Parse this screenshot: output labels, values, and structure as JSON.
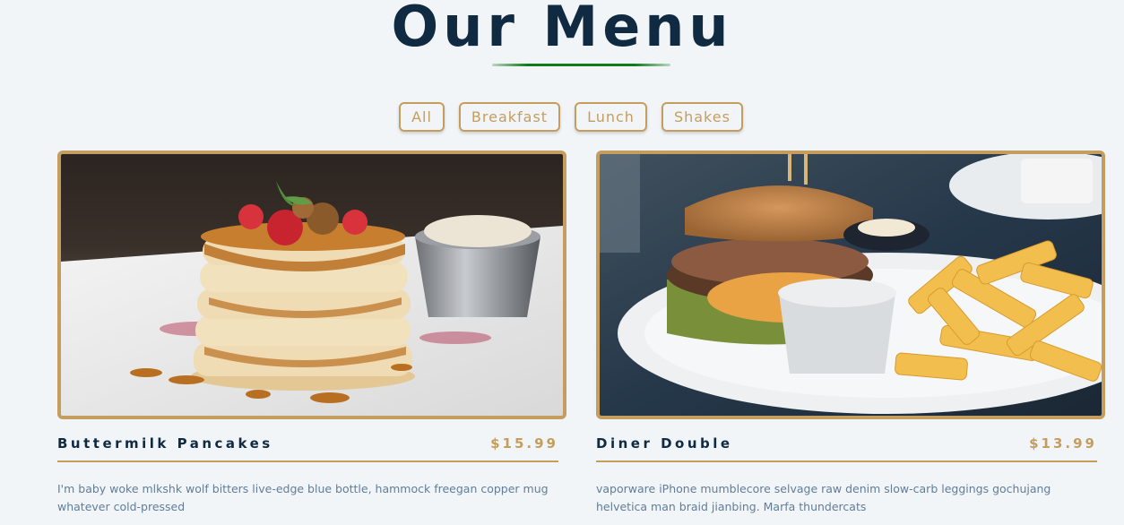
{
  "page": {
    "title": "Our Menu"
  },
  "filters": [
    "All",
    "Breakfast",
    "Lunch",
    "Shakes"
  ],
  "menu": [
    {
      "name": "Buttermilk Pancakes",
      "price": "$15.99",
      "description": "I'm baby woke mlkshk wolf bitters live-edge blue bottle, hammock freegan copper mug whatever cold-pressed",
      "image": "pancakes-photo"
    },
    {
      "name": "Diner Double",
      "price": "$13.99",
      "description": "vaporware iPhone mumblecore selvage raw denim slow-carb leggings gochujang helvetica man braid jianbing. Marfa thundercats",
      "image": "burger-photo"
    }
  ],
  "colors": {
    "background": "#f1f5f8",
    "title": "#102a42",
    "accent": "#c59d5f",
    "underline": "#0f7a1a",
    "description": "#617d98"
  }
}
